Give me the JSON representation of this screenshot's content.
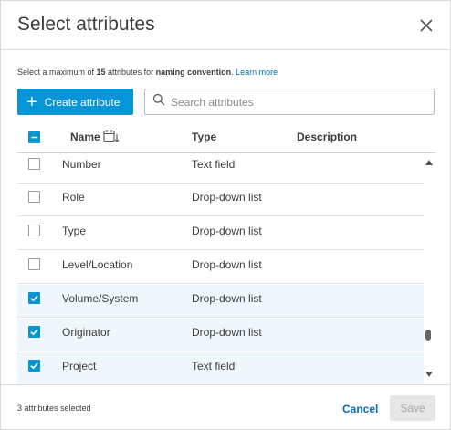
{
  "dialog": {
    "title": "Select attributes"
  },
  "hint": {
    "prefix": "Select a maximum of ",
    "max": "15",
    "middle": " attributes for ",
    "target": "naming convention",
    "period": ".",
    "link": "Learn more"
  },
  "toolbar": {
    "create_label": "Create attribute",
    "search_placeholder": "Search attributes"
  },
  "table": {
    "columns": {
      "name": "Name",
      "type": "Type",
      "description": "Description"
    },
    "select_all_state": "partial",
    "rows": [
      {
        "name": "Number",
        "type": "Text field",
        "checked": false
      },
      {
        "name": "Role",
        "type": "Drop-down list",
        "checked": false
      },
      {
        "name": "Type",
        "type": "Drop-down list",
        "checked": false
      },
      {
        "name": "Level/Location",
        "type": "Drop-down list",
        "checked": false
      },
      {
        "name": "Volume/System",
        "type": "Drop-down list",
        "checked": true
      },
      {
        "name": "Originator",
        "type": "Drop-down list",
        "checked": true
      },
      {
        "name": "Project",
        "type": "Text field",
        "checked": true
      }
    ]
  },
  "footer": {
    "selected_count": "3 attributes selected",
    "cancel_label": "Cancel",
    "save_label": "Save"
  },
  "colors": {
    "accent": "#0696d7",
    "link": "#0070b8",
    "selected_row": "#f0f7fc"
  }
}
